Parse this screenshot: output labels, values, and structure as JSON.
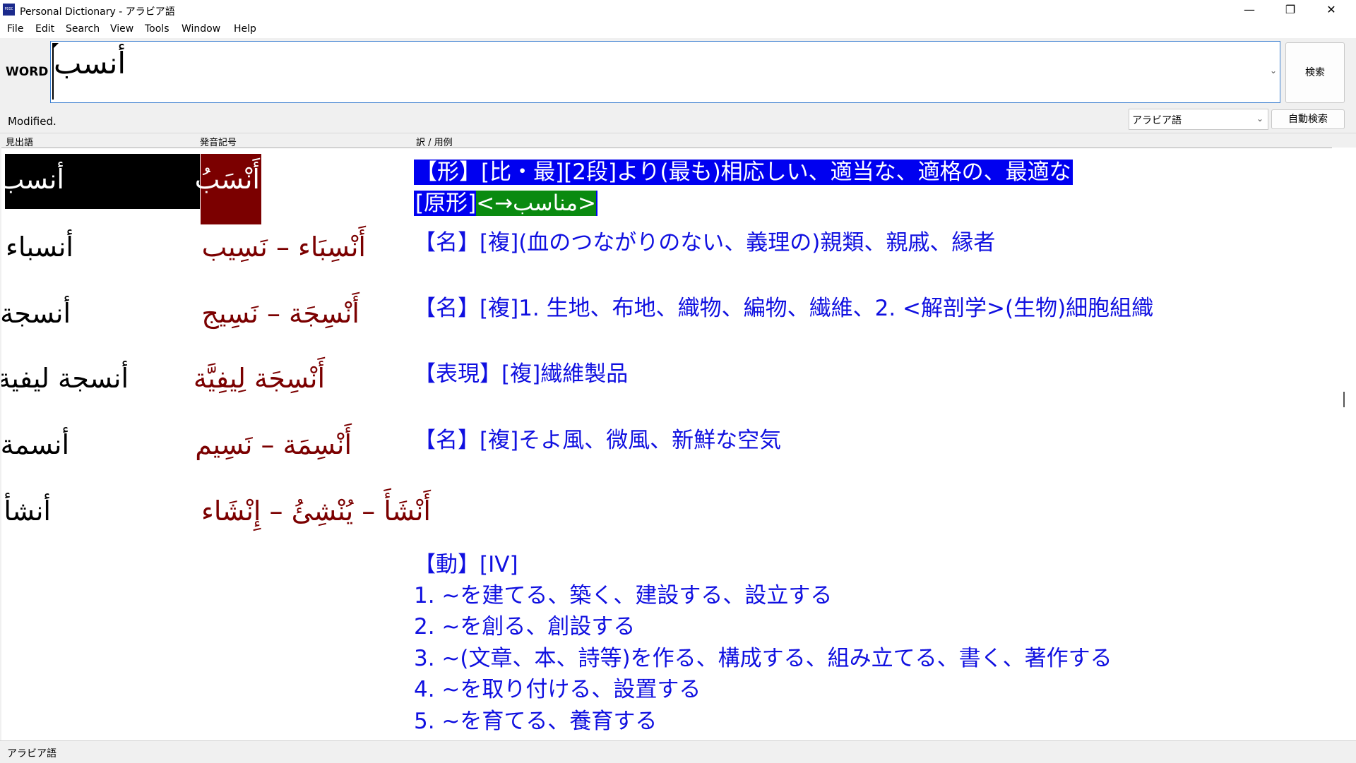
{
  "window": {
    "title": "Personal Dictionary - アラビア語",
    "icon_label": "PDIC",
    "controls": {
      "minimize": "—",
      "maximize": "❐",
      "close": "✕"
    }
  },
  "menu": [
    "File",
    "Edit",
    "Search",
    "View",
    "Tools",
    "Window",
    "Help"
  ],
  "word_bar": {
    "label": "WORD",
    "value": "أنسب",
    "search_button": "検索"
  },
  "status": {
    "text": "Modified.",
    "language": "アラビア語",
    "auto_search": "自動検索"
  },
  "columns": [
    "見出語",
    "発音記号",
    "訳 / 用例"
  ],
  "entries": [
    {
      "headword": "أنسب",
      "pron": "أَنْسَبُ",
      "lines": [
        "【形】[比・最][2段]より(最も)相応しい、適当な、適格の、最適な"
      ],
      "orig_prefix": "[原形]",
      "orig_link": "<→مناسب>"
    },
    {
      "headword": "أنسباء",
      "pron": "أَنْسِبَاء – نَسِيب",
      "lines": [
        "【名】[複](血のつながりのない、義理の)親類、親戚、縁者"
      ]
    },
    {
      "headword": "أنسجة",
      "pron": "أَنْسِجَة – نَسِيج",
      "lines": [
        "【名】[複]1. 生地、布地、織物、編物、繊維、2. <解剖学>(生物)細胞組織"
      ]
    },
    {
      "headword": "أنسجة ليفية",
      "pron": "أَنْسِجَة لِيفِيَّة",
      "lines": [
        "【表現】[複]繊維製品"
      ]
    },
    {
      "headword": "أنسمة",
      "pron": "أَنْسِمَة – نَسِيم",
      "lines": [
        "【名】[複]そよ風、微風、新鮮な空気"
      ]
    },
    {
      "headword": "أنشأ",
      "pron": "أَنْشَأَ – يُنْشِئُ – إِنْشَاء",
      "lines": [
        "【動】[IV]",
        "1. ~を建てる、築く、建設する、設立する",
        "2. ~を創る、創設する",
        "3. ~(文章、本、詩等)を作る、構成する、組み立てる、書く、著作する",
        "4. ~を取り付ける、設置する",
        "5. ~を育てる、養育する"
      ]
    }
  ],
  "bottom_status": "アラビア語",
  "colors": {
    "translation": "#1010e0",
    "pronunciation": "#7b0000",
    "highlight": "#0000f0",
    "link_highlight": "#0a8a10"
  }
}
